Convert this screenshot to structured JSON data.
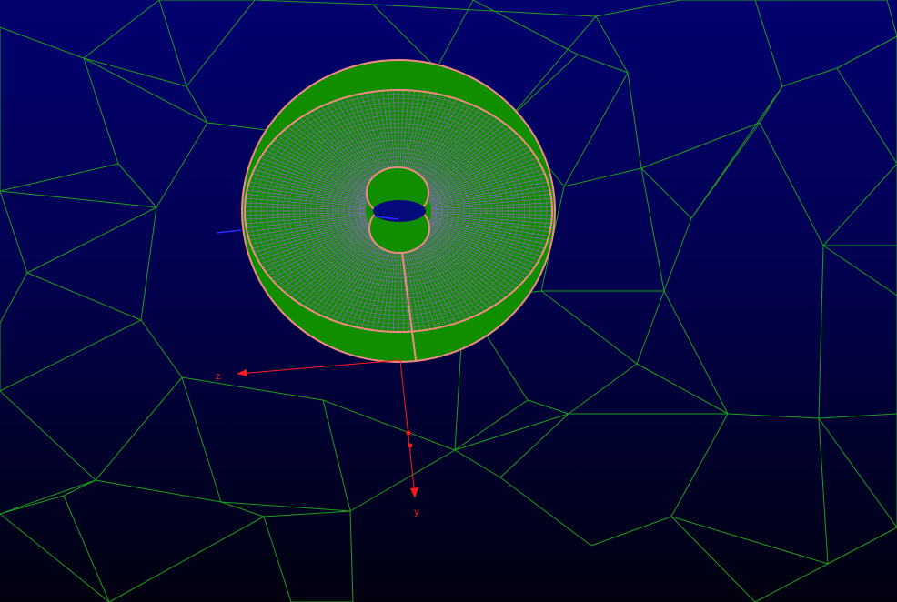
{
  "viewport": {
    "background_top": "#02016f",
    "background_bottom": "#01010f"
  },
  "ground_mesh": {
    "color": "#1d9e1d"
  },
  "model": {
    "fill_color": "#118d00",
    "edge_color": "#f08a83",
    "wireframe_color": "#9a63d9"
  },
  "axes": {
    "color": "#ff1a1a",
    "minor_color": "#2a2aff",
    "z_label": "z",
    "y_label": "y"
  }
}
